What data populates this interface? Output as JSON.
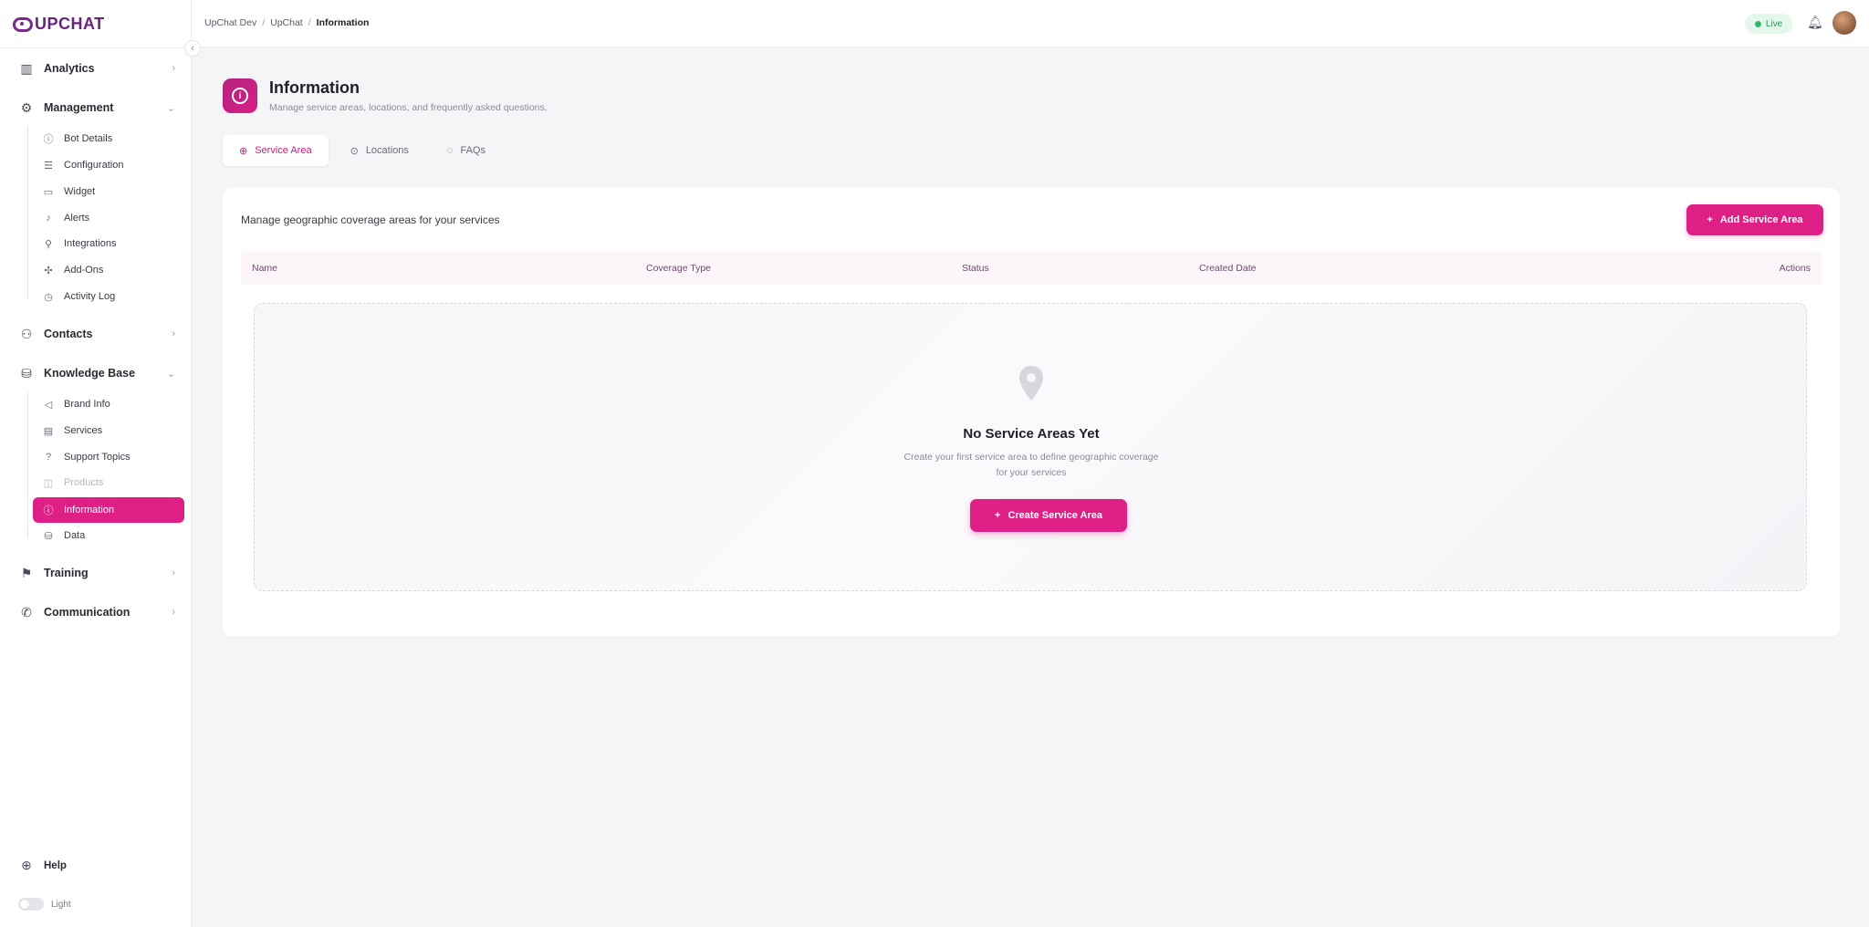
{
  "brand": {
    "name": "UPCHAT",
    "color": "#6b2380"
  },
  "accent": "#de1f86",
  "breadcrumb": [
    "UpChat Dev",
    "UpChat",
    "Information"
  ],
  "status": {
    "label": "Live",
    "color": "#35b86a"
  },
  "sidebar": {
    "groups": [
      {
        "label": "Analytics",
        "icon": "bar-chart-icon"
      },
      {
        "label": "Management",
        "icon": "gear-icon",
        "items": [
          {
            "label": "Bot Details",
            "icon": "info-box-icon"
          },
          {
            "label": "Configuration",
            "icon": "sliders-icon"
          },
          {
            "label": "Widget",
            "icon": "window-icon"
          },
          {
            "label": "Alerts",
            "icon": "bell-icon"
          },
          {
            "label": "Integrations",
            "icon": "plug-icon"
          },
          {
            "label": "Add-Ons",
            "icon": "puzzle-icon"
          },
          {
            "label": "Activity Log",
            "icon": "clock-icon"
          }
        ]
      },
      {
        "label": "Contacts",
        "icon": "users-icon"
      },
      {
        "label": "Knowledge Base",
        "icon": "database-icon",
        "items": [
          {
            "label": "Brand Info",
            "icon": "megaphone-icon"
          },
          {
            "label": "Services",
            "icon": "clipboard-icon"
          },
          {
            "label": "Support Topics",
            "icon": "help-circle-icon"
          },
          {
            "label": "Products",
            "icon": "shopping-bag-icon",
            "state": "disabled"
          },
          {
            "label": "Information",
            "icon": "info-icon",
            "state": "active"
          },
          {
            "label": "Data",
            "icon": "database-small-icon"
          }
        ]
      },
      {
        "label": "Training",
        "icon": "training-icon"
      },
      {
        "label": "Communication",
        "icon": "phone-icon"
      }
    ],
    "help_label": "Help",
    "theme_label": "Light"
  },
  "page": {
    "title": "Information",
    "subtitle": "Manage service areas, locations, and frequently asked questions.",
    "tabs": [
      {
        "label": "Service Area",
        "icon": "globe-icon",
        "active": true
      },
      {
        "label": "Locations",
        "icon": "map-pin-icon",
        "active": false
      },
      {
        "label": "FAQs",
        "icon": "chat-bubble-icon",
        "active": false
      }
    ]
  },
  "service_area": {
    "description": "Manage geographic coverage areas for your services",
    "add_button": "Add Service Area",
    "columns": [
      "Name",
      "Coverage Type",
      "Status",
      "Created Date",
      "Actions"
    ],
    "empty": {
      "title": "No Service Areas Yet",
      "line1": "Create your first service area to define geographic coverage",
      "line2": "for your services",
      "button": "Create Service Area"
    }
  }
}
